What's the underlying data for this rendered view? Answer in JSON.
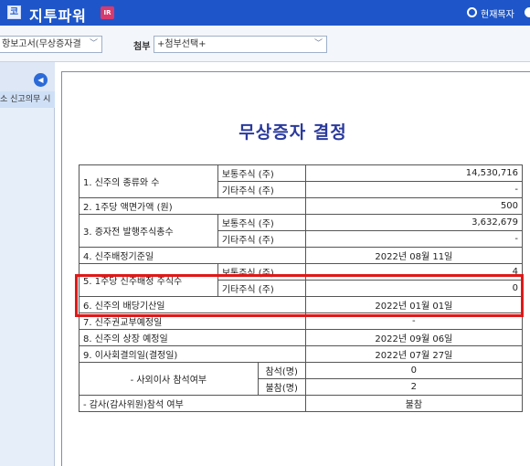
{
  "header": {
    "app_icon_glyph": "코",
    "title": "지투파워",
    "ir_badge": "IR",
    "current_view_label": "현재목자"
  },
  "toolbar": {
    "report_select_value": "항보고서(무상증자결",
    "attach_label": "첨부",
    "attach_select_value": "+첨부선택+"
  },
  "sidebar": {
    "tree_item_label": "소 신고의무 시"
  },
  "document": {
    "title": "무상증자 결정",
    "rows": {
      "r1_label": "1. 신주의 종류와 수",
      "r1_common_label": "보통주식 (주)",
      "r1_common_value": "14,530,716",
      "r1_other_label": "기타주식 (주)",
      "r1_other_value": "-",
      "r2_label": "2. 1주당 액면가액 (원)",
      "r2_value": "500",
      "r3_label": "3. 증자전 발행주식총수",
      "r3_common_label": "보통주식 (주)",
      "r3_common_value": "3,632,679",
      "r3_other_label": "기타주식 (주)",
      "r3_other_value": "-",
      "r4_label": "4. 신주배정기준일",
      "r4_value": "2022년 08월 11일",
      "r5_label": "5. 1주당 신주배정 주식수",
      "r5_common_label": "보통주식 (주)",
      "r5_common_value": "4",
      "r5_other_label": "기타주식 (주)",
      "r5_other_value": "0",
      "r6_label": "6. 신주의 배당기산일",
      "r6_value": "2022년 01월 01일",
      "r7_label": "7. 신주권교부예정일",
      "r7_value": "-",
      "r8_label": "8. 신주의 상장 예정일",
      "r8_value": "2022년 09월 06일",
      "r9_label": "9. 이사회결의일(결정일)",
      "r9_value": "2022년 07월 27일",
      "outside_dir_label": "- 사외이사 참석여부",
      "attend_label": "참석(명)",
      "attend_value": "0",
      "absent_label": "불참(명)",
      "absent_value": "2",
      "auditor_label": "- 감사(감사위원)참석 여부",
      "auditor_value": "불참"
    }
  },
  "colors": {
    "titlebar": "#1e56c9",
    "doc_title": "#2a3a9c",
    "highlight": "#e01818"
  }
}
